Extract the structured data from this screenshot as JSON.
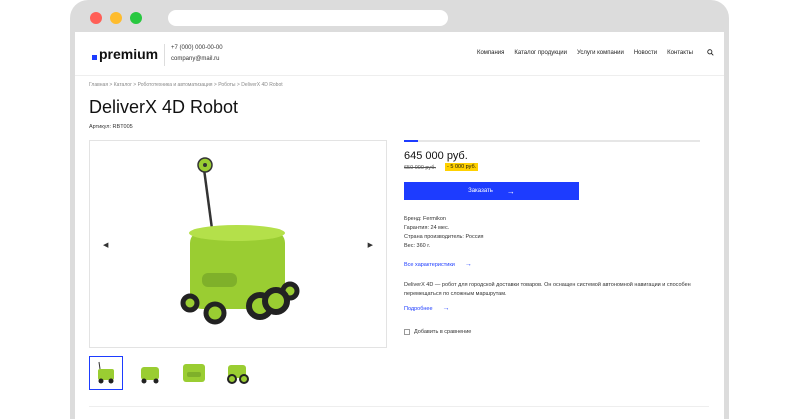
{
  "header": {
    "logo": "premium",
    "phone": "+7 (000) 000-00-00",
    "email": "company@mail.ru",
    "nav": [
      "Компания",
      "Каталог продукции",
      "Услуги компании",
      "Новости",
      "Контакты"
    ]
  },
  "breadcrumbs": "Главная > Каталог > Робототехника и автоматизация > Роботы > DeliverX 4D Robot",
  "product": {
    "title": "DeliverX 4D Robot",
    "sku": "Артикул: RBT005"
  },
  "purchase": {
    "price": "645 000 руб.",
    "old_price": "650 000 руб.",
    "discount": "- 5 000 руб.",
    "order_label": "Заказать"
  },
  "specs": [
    "Бренд: Fermikon",
    "Гарантия: 24 мес.",
    "Страна производитель: Россия",
    "Вес: 360 г."
  ],
  "all_specs_link": "Все характеристики",
  "description": "DeliverX 4D — робот для городской доставки товаров. Он оснащен системой автономной навигации и способен перемещаться по сложным маршрутам.",
  "more_link": "Подробнее",
  "compare_label": "Добавить в сравнение",
  "colors": {
    "accent": "#1d3cff",
    "badge": "#ffd100",
    "robot": "#9acd32"
  }
}
